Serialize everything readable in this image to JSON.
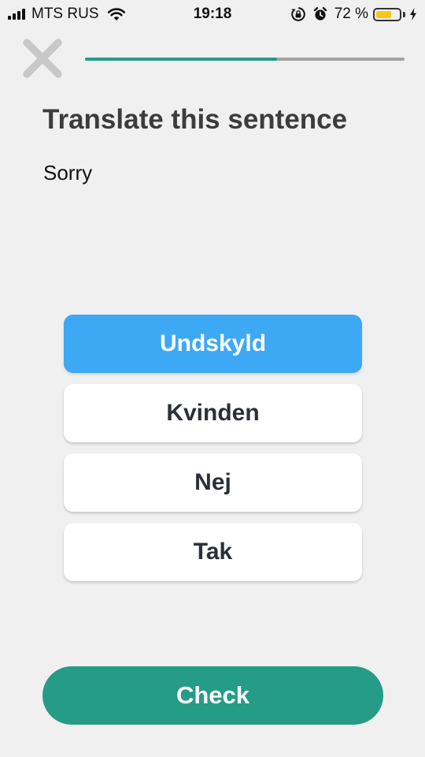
{
  "status_bar": {
    "carrier": "MTS RUS",
    "time": "19:18",
    "battery_percent": "72 %",
    "battery_level": 0.72,
    "icons": [
      "signal-icon",
      "wifi-icon",
      "rotation-lock-icon",
      "alarm-icon",
      "battery-icon",
      "charging-icon"
    ]
  },
  "lesson": {
    "progress": 0.6,
    "close_icon": "close-icon",
    "prompt": "Translate this sentence",
    "sentence": "Sorry"
  },
  "options": [
    {
      "label": "Undskyld",
      "selected": true
    },
    {
      "label": "Kvinden",
      "selected": false
    },
    {
      "label": "Nej",
      "selected": false
    },
    {
      "label": "Tak",
      "selected": false
    }
  ],
  "actions": {
    "check_label": "Check"
  },
  "colors": {
    "accent": "#259c86",
    "selected": "#3da9f5",
    "background": "#f0f0f0",
    "battery": "#f5c71a"
  }
}
